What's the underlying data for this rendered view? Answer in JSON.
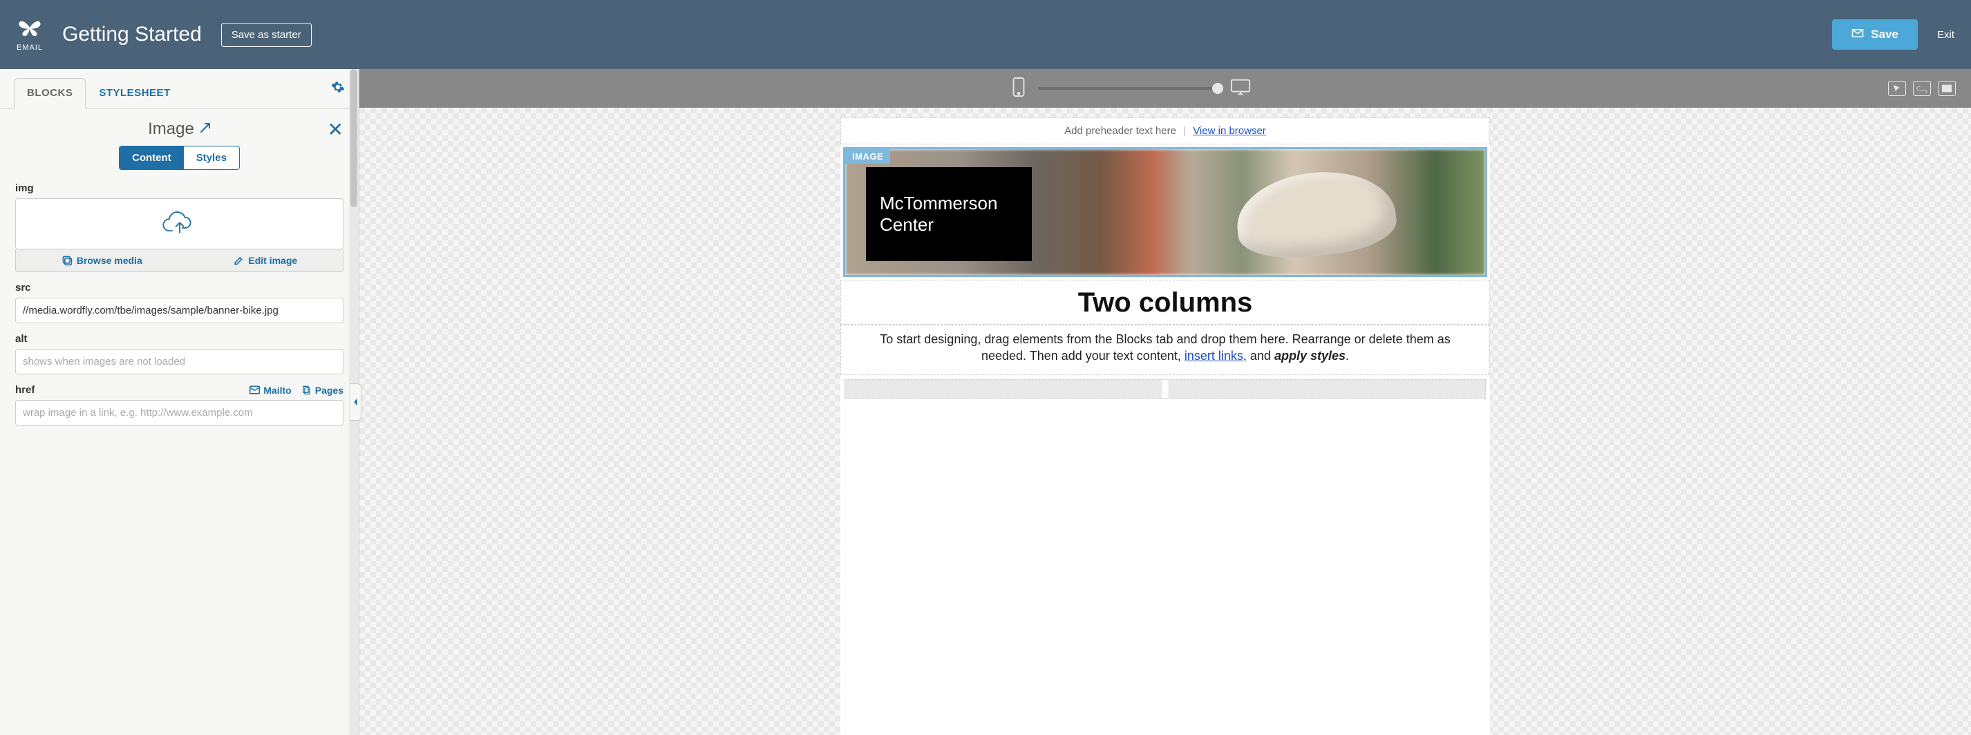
{
  "header": {
    "logo_label": "EMAIL",
    "title": "Getting Started",
    "save_starter": "Save as starter",
    "save": "Save",
    "exit": "Exit"
  },
  "tabs": {
    "blocks": "BLOCKS",
    "stylesheet": "STYLESHEET"
  },
  "block": {
    "title": "Image",
    "toggle_content": "Content",
    "toggle_styles": "Styles"
  },
  "fields": {
    "img_label": "img",
    "browse": "Browse media",
    "edit": "Edit image",
    "src_label": "src",
    "src_value": "//media.wordfly.com/tbe/images/sample/banner-bike.jpg",
    "alt_label": "alt",
    "alt_placeholder": "shows when images are not loaded",
    "href_label": "href",
    "mailto": "Mailto",
    "pages": "Pages",
    "href_placeholder": "wrap image in a link, e.g. http://www.example.com"
  },
  "canvas": {
    "preheader_text": "Add preheader text here",
    "preheader_sep": "|",
    "view_browser": "View in browser",
    "image_tag": "IMAGE",
    "logo_line1": "McTommerson",
    "logo_line2": "Center",
    "headline": "Two columns",
    "body_pre": "To start designing, drag elements from the Blocks tab and drop them here. Rearrange or delete them as needed. Then add your text content, ",
    "body_link": "insert links",
    "body_mid": ", and ",
    "body_apply": "apply styles",
    "body_end": "."
  }
}
